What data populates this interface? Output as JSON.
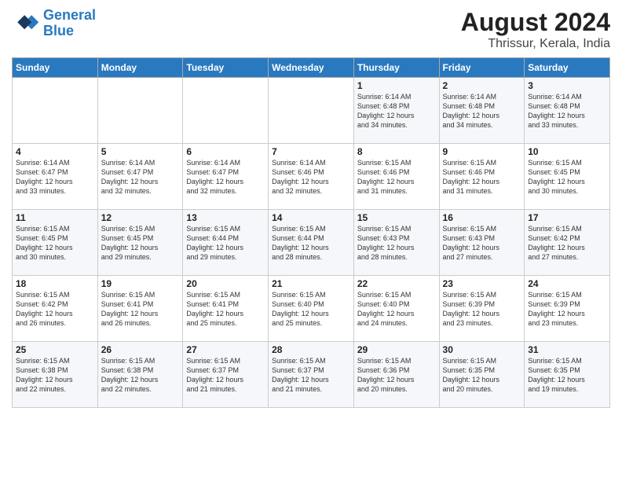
{
  "header": {
    "logo_line1": "General",
    "logo_line2": "Blue",
    "title": "August 2024",
    "subtitle": "Thrissur, Kerala, India"
  },
  "days_of_week": [
    "Sunday",
    "Monday",
    "Tuesday",
    "Wednesday",
    "Thursday",
    "Friday",
    "Saturday"
  ],
  "weeks": [
    [
      {
        "day": "",
        "info": ""
      },
      {
        "day": "",
        "info": ""
      },
      {
        "day": "",
        "info": ""
      },
      {
        "day": "",
        "info": ""
      },
      {
        "day": "1",
        "info": "Sunrise: 6:14 AM\nSunset: 6:48 PM\nDaylight: 12 hours\nand 34 minutes."
      },
      {
        "day": "2",
        "info": "Sunrise: 6:14 AM\nSunset: 6:48 PM\nDaylight: 12 hours\nand 34 minutes."
      },
      {
        "day": "3",
        "info": "Sunrise: 6:14 AM\nSunset: 6:48 PM\nDaylight: 12 hours\nand 33 minutes."
      }
    ],
    [
      {
        "day": "4",
        "info": "Sunrise: 6:14 AM\nSunset: 6:47 PM\nDaylight: 12 hours\nand 33 minutes."
      },
      {
        "day": "5",
        "info": "Sunrise: 6:14 AM\nSunset: 6:47 PM\nDaylight: 12 hours\nand 32 minutes."
      },
      {
        "day": "6",
        "info": "Sunrise: 6:14 AM\nSunset: 6:47 PM\nDaylight: 12 hours\nand 32 minutes."
      },
      {
        "day": "7",
        "info": "Sunrise: 6:14 AM\nSunset: 6:46 PM\nDaylight: 12 hours\nand 32 minutes."
      },
      {
        "day": "8",
        "info": "Sunrise: 6:15 AM\nSunset: 6:46 PM\nDaylight: 12 hours\nand 31 minutes."
      },
      {
        "day": "9",
        "info": "Sunrise: 6:15 AM\nSunset: 6:46 PM\nDaylight: 12 hours\nand 31 minutes."
      },
      {
        "day": "10",
        "info": "Sunrise: 6:15 AM\nSunset: 6:45 PM\nDaylight: 12 hours\nand 30 minutes."
      }
    ],
    [
      {
        "day": "11",
        "info": "Sunrise: 6:15 AM\nSunset: 6:45 PM\nDaylight: 12 hours\nand 30 minutes."
      },
      {
        "day": "12",
        "info": "Sunrise: 6:15 AM\nSunset: 6:45 PM\nDaylight: 12 hours\nand 29 minutes."
      },
      {
        "day": "13",
        "info": "Sunrise: 6:15 AM\nSunset: 6:44 PM\nDaylight: 12 hours\nand 29 minutes."
      },
      {
        "day": "14",
        "info": "Sunrise: 6:15 AM\nSunset: 6:44 PM\nDaylight: 12 hours\nand 28 minutes."
      },
      {
        "day": "15",
        "info": "Sunrise: 6:15 AM\nSunset: 6:43 PM\nDaylight: 12 hours\nand 28 minutes."
      },
      {
        "day": "16",
        "info": "Sunrise: 6:15 AM\nSunset: 6:43 PM\nDaylight: 12 hours\nand 27 minutes."
      },
      {
        "day": "17",
        "info": "Sunrise: 6:15 AM\nSunset: 6:42 PM\nDaylight: 12 hours\nand 27 minutes."
      }
    ],
    [
      {
        "day": "18",
        "info": "Sunrise: 6:15 AM\nSunset: 6:42 PM\nDaylight: 12 hours\nand 26 minutes."
      },
      {
        "day": "19",
        "info": "Sunrise: 6:15 AM\nSunset: 6:41 PM\nDaylight: 12 hours\nand 26 minutes."
      },
      {
        "day": "20",
        "info": "Sunrise: 6:15 AM\nSunset: 6:41 PM\nDaylight: 12 hours\nand 25 minutes."
      },
      {
        "day": "21",
        "info": "Sunrise: 6:15 AM\nSunset: 6:40 PM\nDaylight: 12 hours\nand 25 minutes."
      },
      {
        "day": "22",
        "info": "Sunrise: 6:15 AM\nSunset: 6:40 PM\nDaylight: 12 hours\nand 24 minutes."
      },
      {
        "day": "23",
        "info": "Sunrise: 6:15 AM\nSunset: 6:39 PM\nDaylight: 12 hours\nand 23 minutes."
      },
      {
        "day": "24",
        "info": "Sunrise: 6:15 AM\nSunset: 6:39 PM\nDaylight: 12 hours\nand 23 minutes."
      }
    ],
    [
      {
        "day": "25",
        "info": "Sunrise: 6:15 AM\nSunset: 6:38 PM\nDaylight: 12 hours\nand 22 minutes."
      },
      {
        "day": "26",
        "info": "Sunrise: 6:15 AM\nSunset: 6:38 PM\nDaylight: 12 hours\nand 22 minutes."
      },
      {
        "day": "27",
        "info": "Sunrise: 6:15 AM\nSunset: 6:37 PM\nDaylight: 12 hours\nand 21 minutes."
      },
      {
        "day": "28",
        "info": "Sunrise: 6:15 AM\nSunset: 6:37 PM\nDaylight: 12 hours\nand 21 minutes."
      },
      {
        "day": "29",
        "info": "Sunrise: 6:15 AM\nSunset: 6:36 PM\nDaylight: 12 hours\nand 20 minutes."
      },
      {
        "day": "30",
        "info": "Sunrise: 6:15 AM\nSunset: 6:35 PM\nDaylight: 12 hours\nand 20 minutes."
      },
      {
        "day": "31",
        "info": "Sunrise: 6:15 AM\nSunset: 6:35 PM\nDaylight: 12 hours\nand 19 minutes."
      }
    ]
  ]
}
